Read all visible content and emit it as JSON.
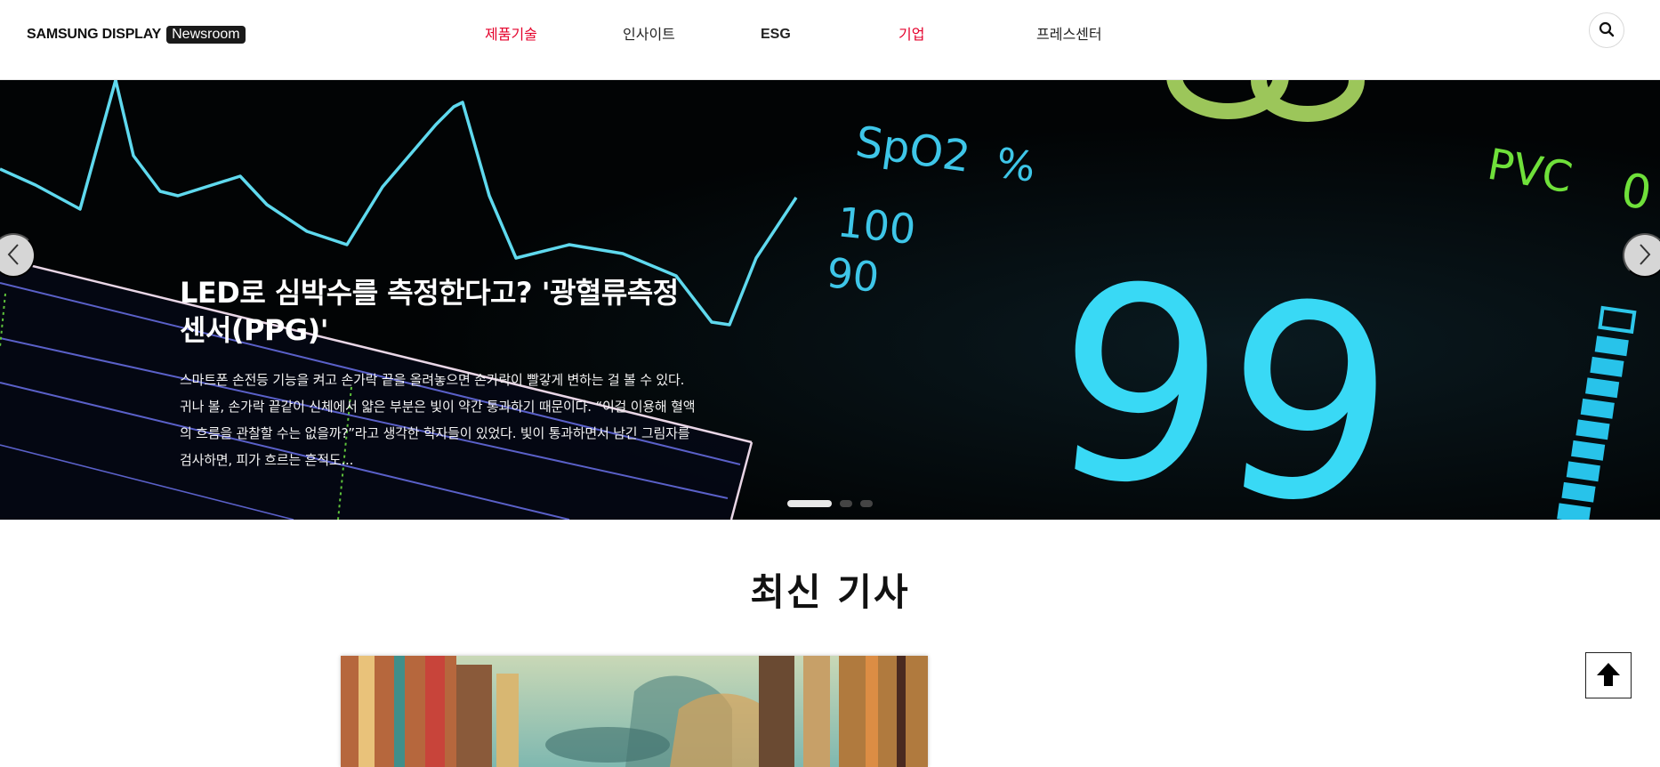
{
  "header": {
    "logo_brand": "SAMSUNG DISPLAY",
    "logo_badge": "Newsroom",
    "nav": [
      {
        "label": "제품기술"
      },
      {
        "label": "인사이트"
      },
      {
        "label": "ESG"
      },
      {
        "label": "기업"
      },
      {
        "label": "프레스센터"
      }
    ],
    "search_icon": "search-icon"
  },
  "hero": {
    "title": "LED로 심박수를 측정한다고? '광혈류측정 센서(PPG)'",
    "description": "스마트폰 손전등 기능을 켜고 손가락 끝을 올려놓으면 손가락이 빨갛게 변하는 걸 볼 수 있다. 귀나 볼, 손가락 끝같이 신체에서 얇은 부분은 빛이 약간 통과하기 때문이다. “이걸 이용해 혈액의 흐름을 관찰할 수는 없을까?”라고 생각한 학자들이 있었다. 빛이 통과하면서 남긴 그림자를 검사하면, 피가 흐르는 흔적도...",
    "monitor": {
      "spo2_label": "SpO2",
      "percent": "%",
      "scale_100": "100",
      "scale_90": "90",
      "reading": "99",
      "pvc_label": "PVC",
      "pvc_value": "0"
    },
    "slides_total": 3,
    "slide_active": 1
  },
  "latest": {
    "title": "최신 기사"
  },
  "colors": {
    "accent": "#e4002b",
    "cyan": "#39d6f0",
    "green": "#6fe03a"
  }
}
